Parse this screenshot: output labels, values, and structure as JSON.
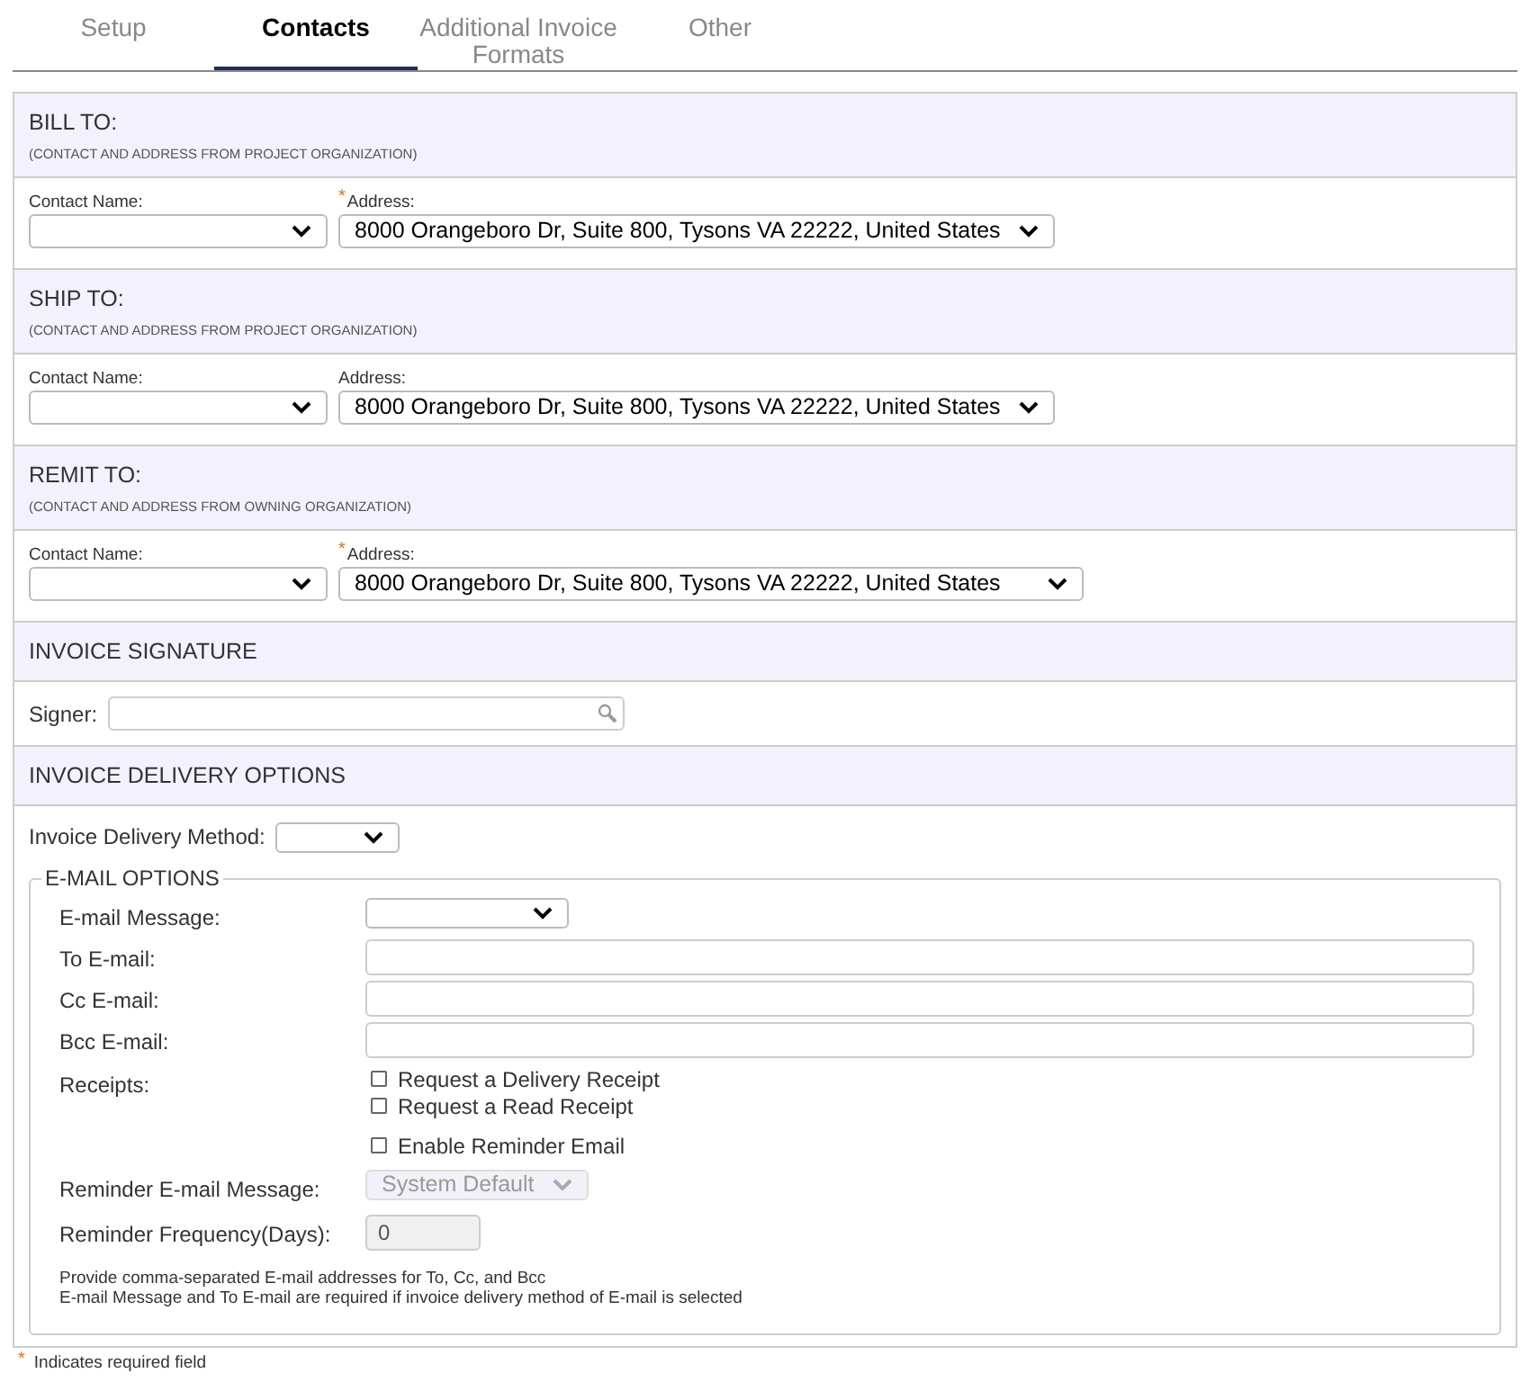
{
  "tabs": [
    {
      "label": "Setup",
      "selected": false
    },
    {
      "label": "Contacts",
      "selected": true
    },
    {
      "label": "Additional Invoice Formats",
      "selected": false
    },
    {
      "label": "Other",
      "selected": false
    }
  ],
  "contact_sections": [
    {
      "title": "BILL TO:",
      "subtitle": "(CONTACT AND ADDRESS FROM PROJECT ORGANIZATION)",
      "contact_label": "Contact Name:",
      "address_label": "Address:",
      "address_required": true,
      "address_value": "8000 Orangeboro Dr, Suite 800, Tysons VA 22222, United States"
    },
    {
      "title": "SHIP TO:",
      "subtitle": "(CONTACT AND ADDRESS FROM PROJECT ORGANIZATION)",
      "contact_label": "Contact Name:",
      "address_label": "Address:",
      "address_required": false,
      "address_value": "8000 Orangeboro Dr, Suite 800, Tysons VA 22222, United States"
    },
    {
      "title": "REMIT TO:",
      "subtitle": "(CONTACT AND ADDRESS FROM OWNING ORGANIZATION)",
      "contact_label": "Contact Name:",
      "address_label": "Address:",
      "address_required": true,
      "address_value": "8000 Orangeboro Dr, Suite 800, Tysons VA 22222, United States"
    }
  ],
  "signature": {
    "title": "INVOICE SIGNATURE",
    "signer_label": "Signer:"
  },
  "delivery": {
    "title": "INVOICE DELIVERY OPTIONS",
    "method_label": "Invoice Delivery Method:",
    "email_options": {
      "legend": "E-MAIL OPTIONS",
      "rows": [
        {
          "kind": "select",
          "label": "E-mail Message:",
          "disabled": false
        },
        {
          "kind": "text",
          "label": "To E-mail:"
        },
        {
          "kind": "text",
          "label": "Cc E-mail:"
        },
        {
          "kind": "text",
          "label": "Bcc E-mail:"
        },
        {
          "kind": "checks",
          "label": "Receipts:",
          "options": [
            {
              "label": "Request a Delivery Receipt",
              "checked": false
            },
            {
              "label": "Request a Read Receipt",
              "checked": false
            }
          ]
        },
        {
          "kind": "checks",
          "label": "",
          "options": [
            {
              "label": "Enable Reminder Email",
              "checked": false
            }
          ]
        },
        {
          "kind": "select",
          "label": "Reminder E-mail Message:",
          "value": "System Default",
          "disabled": true
        },
        {
          "kind": "number",
          "label": "Reminder Frequency(Days):",
          "value": "0",
          "disabled": true
        }
      ],
      "notes": [
        "Provide comma-separated E-mail addresses for To, Cc, and Bcc",
        "E-mail Message and To E-mail are required if invoice delivery method of E-mail is selected"
      ]
    }
  },
  "footer": {
    "mark": "*",
    "text": "Indicates required field"
  }
}
